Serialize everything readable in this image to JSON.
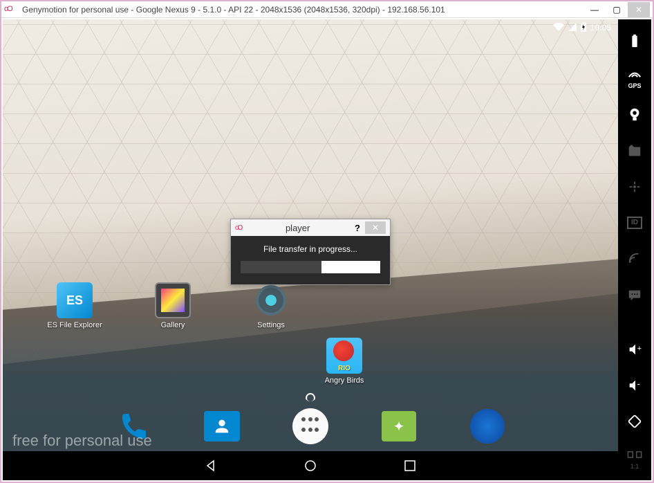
{
  "window": {
    "title": "Genymotion for personal use - Google Nexus 9 - 5.1.0 - API 22 - 2048x1536 (2048x1536, 320dpi) - 192.168.56.101"
  },
  "status_bar": {
    "time": "10:05"
  },
  "home_apps": [
    {
      "label": "ES File Explorer",
      "icon": "es-icon"
    },
    {
      "label": "Gallery",
      "icon": "gallery-icon"
    },
    {
      "label": "Settings",
      "icon": "settings-icon"
    },
    {
      "label": "Angry Birds",
      "icon": "angry-icon",
      "badge": "RIO"
    }
  ],
  "dialog": {
    "title": "player",
    "message": "File transfer in progress...",
    "progress_percent": 58
  },
  "watermark": "free for personal use",
  "sidebar": {
    "gps_label": "GPS",
    "id_label": "ID",
    "scale_label": "1:1"
  }
}
